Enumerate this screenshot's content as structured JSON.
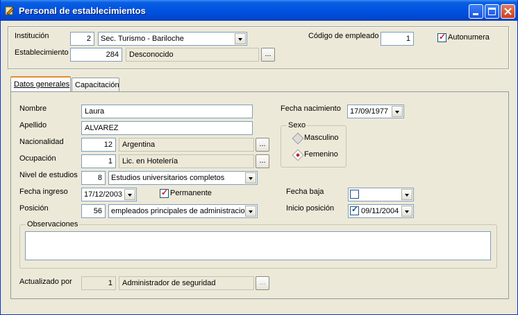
{
  "window": {
    "title": "Personal de establecimientos"
  },
  "header": {
    "institucion_label": "Institución",
    "institucion_code": "2",
    "institucion_value": "Sec. Turismo - Bariloche",
    "establecimiento_label": "Establecimiento",
    "establecimiento_code": "284",
    "establecimiento_value": "Desconocido",
    "codigo_empleado_label": "Código de empleado",
    "codigo_empleado_value": "1",
    "autonumera_label": "Autonumera",
    "ellipsis": "..."
  },
  "tabs": [
    {
      "label": "Datos generales"
    },
    {
      "label": "Capacitación"
    }
  ],
  "form": {
    "nombre_label": "Nombre",
    "nombre_value": "Laura",
    "apellido_label": "Apellido",
    "apellido_value": "ALVAREZ",
    "nacionalidad_label": "Nacionalidad",
    "nacionalidad_code": "12",
    "nacionalidad_value": "Argentina",
    "ocupacion_label": "Ocupación",
    "ocupacion_code": "1",
    "ocupacion_value": "Lic. en Hotelería",
    "nivel_label": "Nivel de estudios",
    "nivel_code": "8",
    "nivel_value": "Estudios universitarios completos",
    "fecha_ingreso_label": "Fecha ingreso",
    "fecha_ingreso_value": "17/12/2003",
    "permanente_label": "Permanente",
    "posicion_label": "Posición",
    "posicion_code": "56",
    "posicion_value": "empleados principales de administracion",
    "fecha_nacimiento_label": "Fecha nacimiento",
    "fecha_nacimiento_value": "17/09/1977",
    "sexo_label": "Sexo",
    "masculino_label": "Masculino",
    "femenino_label": "Femenino",
    "fecha_baja_label": "Fecha baja",
    "fecha_baja_value": "",
    "inicio_posicion_label": "Inicio posición",
    "inicio_posicion_value": "09/11/2004",
    "observaciones_label": "Observaciones",
    "actualizado_label": "Actualizado por",
    "actualizado_code": "1",
    "actualizado_value": "Administrador de seguridad"
  }
}
